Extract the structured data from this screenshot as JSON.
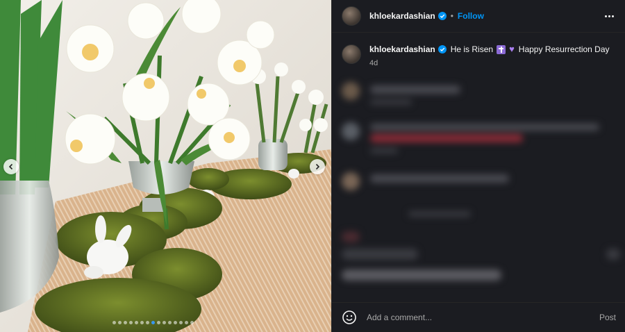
{
  "post": {
    "username": "khloekardashian",
    "follow_label": "Follow",
    "separator": "•",
    "caption": {
      "username": "khloekardashian",
      "text_part1": "He is Risen",
      "text_part2": "Happy Resurrection Day",
      "emojis": [
        "latin-cross",
        "purple-heart"
      ]
    },
    "timestamp": "4d",
    "carousel": {
      "count": 15,
      "active_index": 7
    }
  },
  "composer": {
    "placeholder": "Add a comment...",
    "post_label": "Post"
  },
  "colors": {
    "panel_bg": "#1b1c21",
    "accent": "#0095f6",
    "verified": "#0095f6",
    "muted": "#a8a8a8"
  },
  "icons": [
    "verified-badge-icon",
    "more-options-icon",
    "chevron-left-icon",
    "chevron-right-icon",
    "emoji-icon"
  ]
}
